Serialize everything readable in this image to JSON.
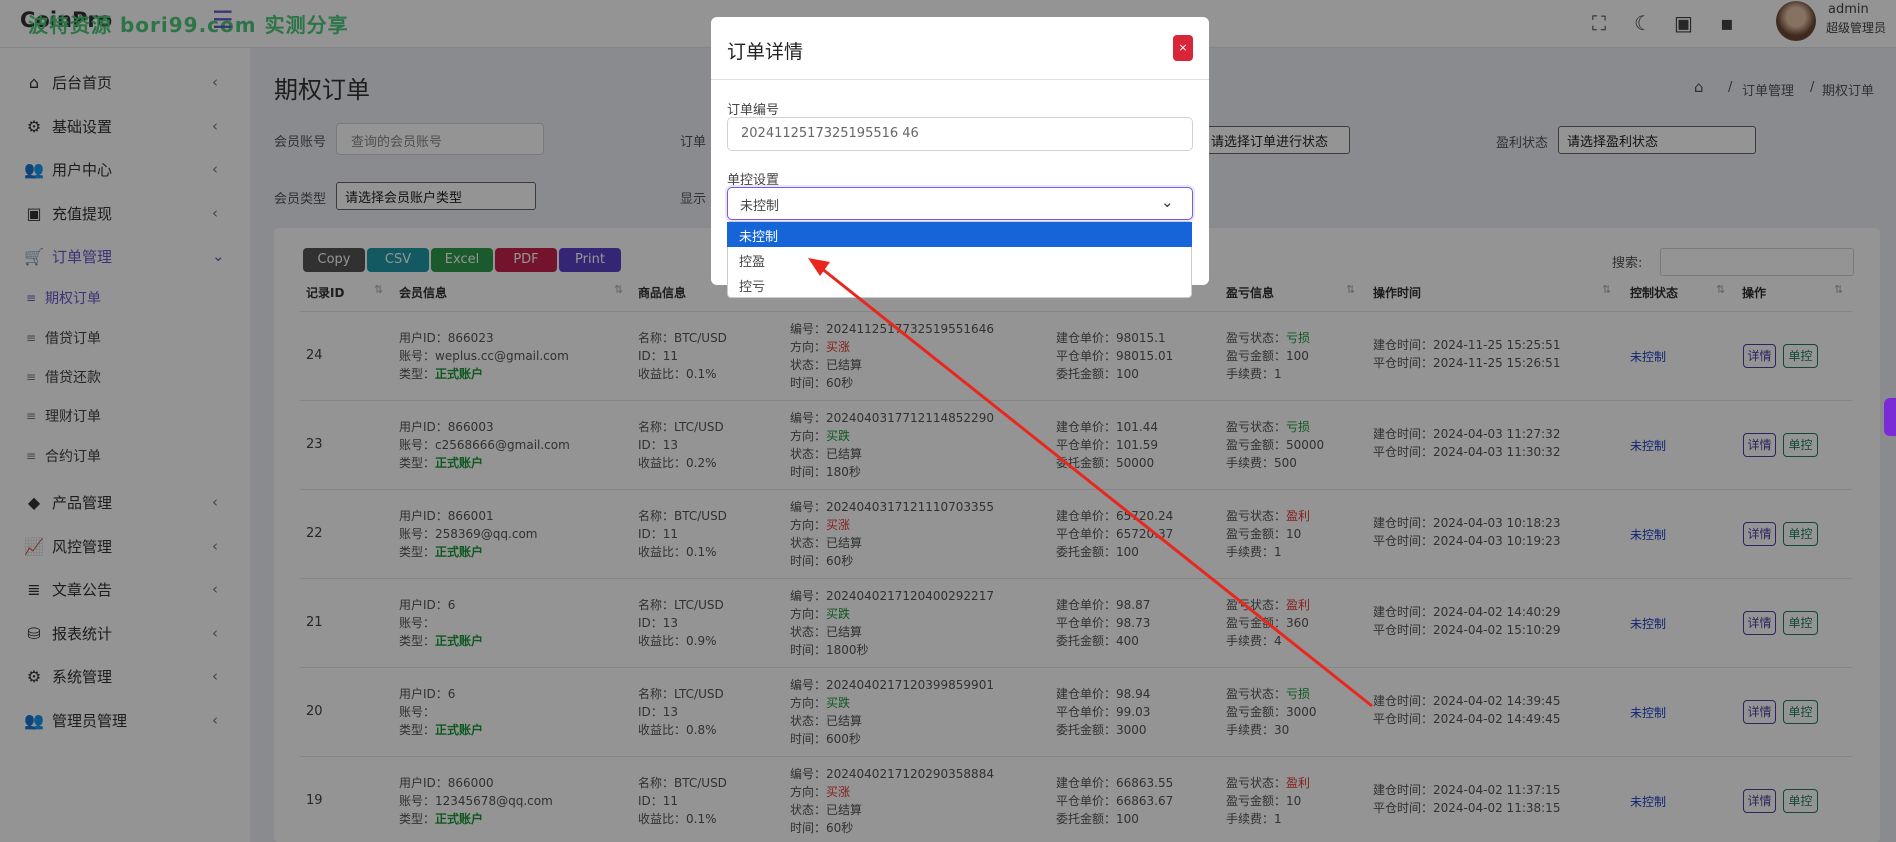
{
  "header": {
    "logo": "CoinPro",
    "watermark": "波特资源 bori99.com 实测分享",
    "user_name": "admin",
    "user_role": "超级管理员"
  },
  "sidebar": {
    "items": [
      {
        "label": "后台首页",
        "icon": "home-icon"
      },
      {
        "label": "基础设置",
        "icon": "gears-icon"
      },
      {
        "label": "用户中心",
        "icon": "users-icon"
      },
      {
        "label": "充值提现",
        "icon": "money-icon"
      },
      {
        "label": "订单管理",
        "icon": "cart-icon"
      },
      {
        "label": "产品管理",
        "icon": "box-icon"
      },
      {
        "label": "风控管理",
        "icon": "chart-line-icon"
      },
      {
        "label": "文章公告",
        "icon": "layers-icon"
      },
      {
        "label": "报表统计",
        "icon": "database-icon"
      },
      {
        "label": "系统管理",
        "icon": "gear-icon"
      },
      {
        "label": "管理员管理",
        "icon": "user-group-icon"
      }
    ],
    "sub_items": [
      "期权订单",
      "借贷订单",
      "借贷还款",
      "理财订单",
      "合约订单"
    ]
  },
  "page": {
    "title": "期权订单",
    "breadcrumb": [
      "订单管理",
      "期权订单"
    ]
  },
  "filters": {
    "member_account_label": "会员账号",
    "member_account_placeholder": "查询的会员账号",
    "order_label": "订单",
    "order_status_value": "请选择订单进行状态",
    "profit_label": "盈利状态",
    "profit_value": "请选择盈利状态",
    "member_type_label": "会员类型",
    "member_type_value": "请选择会员账户类型",
    "show_label": "显示"
  },
  "toolbar": {
    "buttons": [
      {
        "label": "Copy",
        "color": "#555555"
      },
      {
        "label": "CSV",
        "color": "#1f9aa8"
      },
      {
        "label": "Excel",
        "color": "#2e9b4f"
      },
      {
        "label": "PDF",
        "color": "#c8224d"
      },
      {
        "label": "Print",
        "color": "#5a43c9"
      }
    ],
    "search_label": "搜索:"
  },
  "table": {
    "columns": [
      "记录ID",
      "会员信息",
      "商品信息",
      "",
      "",
      "盈亏信息",
      "操作时间",
      "控制状态",
      "操作"
    ],
    "rows": [
      {
        "id": "24",
        "uid": "用户ID：866023",
        "acct": "账号：weplus.cc@gmail.com",
        "type": "正式账户",
        "p_name": "名称：BTC/USD",
        "p_id": "ID：11",
        "p_ratio": "收益比：0.1%",
        "o_no": "编号：2024112517732519551646",
        "o_dir": "买涨",
        "o_state": "已结算",
        "o_time": "时间：60秒",
        "open": "建仓单价：98015.1",
        "close": "平仓单价：98015.01",
        "amount": "委托金额：100",
        "pl_state": "亏损",
        "pl_amt": "盈亏金额：100",
        "fee": "手续费：1",
        "t_open": "建仓时间：2024-11-25 15:25:51",
        "t_close": "平仓时间：2024-11-25 15:26:51",
        "ctrl": "未控制",
        "detail": "详情",
        "single": "单控"
      },
      {
        "id": "23",
        "uid": "用户ID：866003",
        "acct": "账号：c2568666@gmail.com",
        "type": "正式账户",
        "p_name": "名称：LTC/USD",
        "p_id": "ID：13",
        "p_ratio": "收益比：0.2%",
        "o_no": "编号：2024040317712114852290",
        "o_dir": "买跌",
        "o_state": "已结算",
        "o_time": "时间：180秒",
        "open": "建仓单价：101.44",
        "close": "平仓单价：101.59",
        "amount": "委托金额：50000",
        "pl_state": "亏损",
        "pl_amt": "盈亏金额：50000",
        "fee": "手续费：500",
        "t_open": "建仓时间：2024-04-03 11:27:32",
        "t_close": "平仓时间：2024-04-03 11:30:32",
        "ctrl": "未控制",
        "detail": "详情",
        "single": "单控"
      },
      {
        "id": "22",
        "uid": "用户ID：866001",
        "acct": "账号：258369@qq.com",
        "type": "正式账户",
        "p_name": "名称：BTC/USD",
        "p_id": "ID：11",
        "p_ratio": "收益比：0.1%",
        "o_no": "编号：2024040317121110703355",
        "o_dir": "买涨",
        "o_state": "已结算",
        "o_time": "时间：60秒",
        "open": "建仓单价：65720.24",
        "close": "平仓单价：65720.37",
        "amount": "委托金额：100",
        "pl_state": "盈利",
        "pl_amt": "盈亏金额：10",
        "fee": "手续费：1",
        "t_open": "建仓时间：2024-04-03 10:18:23",
        "t_close": "平仓时间：2024-04-03 10:19:23",
        "ctrl": "未控制",
        "detail": "详情",
        "single": "单控"
      },
      {
        "id": "21",
        "uid": "用户ID：6",
        "acct": "账号：",
        "type": "正式账户",
        "p_name": "名称：LTC/USD",
        "p_id": "ID：13",
        "p_ratio": "收益比：0.9%",
        "o_no": "编号：2024040217120400292217",
        "o_dir": "买跌",
        "o_state": "已结算",
        "o_time": "时间：1800秒",
        "open": "建仓单价：98.87",
        "close": "平仓单价：98.73",
        "amount": "委托金额：400",
        "pl_state": "盈利",
        "pl_amt": "盈亏金额：360",
        "fee": "手续费：4",
        "t_open": "建仓时间：2024-04-02 14:40:29",
        "t_close": "平仓时间：2024-04-02 15:10:29",
        "ctrl": "未控制",
        "detail": "详情",
        "single": "单控"
      },
      {
        "id": "20",
        "uid": "用户ID：6",
        "acct": "账号：",
        "type": "正式账户",
        "p_name": "名称：LTC/USD",
        "p_id": "ID：13",
        "p_ratio": "收益比：0.8%",
        "o_no": "编号：2024040217120399859901",
        "o_dir": "买跌",
        "o_state": "已结算",
        "o_time": "时间：600秒",
        "open": "建仓单价：98.94",
        "close": "平仓单价：99.03",
        "amount": "委托金额：3000",
        "pl_state": "亏损",
        "pl_amt": "盈亏金额：3000",
        "fee": "手续费：30",
        "t_open": "建仓时间：2024-04-02 14:39:45",
        "t_close": "平仓时间：2024-04-02 14:49:45",
        "ctrl": "未控制",
        "detail": "详情",
        "single": "单控"
      },
      {
        "id": "19",
        "uid": "用户ID：866000",
        "acct": "账号：12345678@qq.com",
        "type": "正式账户",
        "p_name": "名称：BTC/USD",
        "p_id": "ID：11",
        "p_ratio": "收益比：0.1%",
        "o_no": "编号：2024040217120290358884",
        "o_dir": "买涨",
        "o_state": "已结算",
        "o_time": "时间：60秒",
        "open": "建仓单价：66863.55",
        "close": "平仓单价：66863.67",
        "amount": "委托金额：100",
        "pl_state": "盈利",
        "pl_amt": "盈亏金额：10",
        "fee": "手续费：1",
        "t_open": "建仓时间：2024-04-02 11:37:15",
        "t_close": "平仓时间：2024-04-02 11:38:15",
        "ctrl": "未控制",
        "detail": "详情",
        "single": "单控"
      }
    ],
    "labels": {
      "type_prefix": "类型：",
      "dir_prefix": "方向：",
      "state_prefix": "状态：",
      "pl_prefix": "盈亏状态："
    }
  },
  "modal": {
    "title": "订单详情",
    "close_label": "×",
    "order_no_label": "订单编号",
    "order_no_value": "2024112517325195516 46",
    "control_label": "单控设置",
    "control_value": "未控制",
    "options": [
      "未控制",
      "控盈",
      "控亏"
    ],
    "selected_option": "未控制"
  }
}
